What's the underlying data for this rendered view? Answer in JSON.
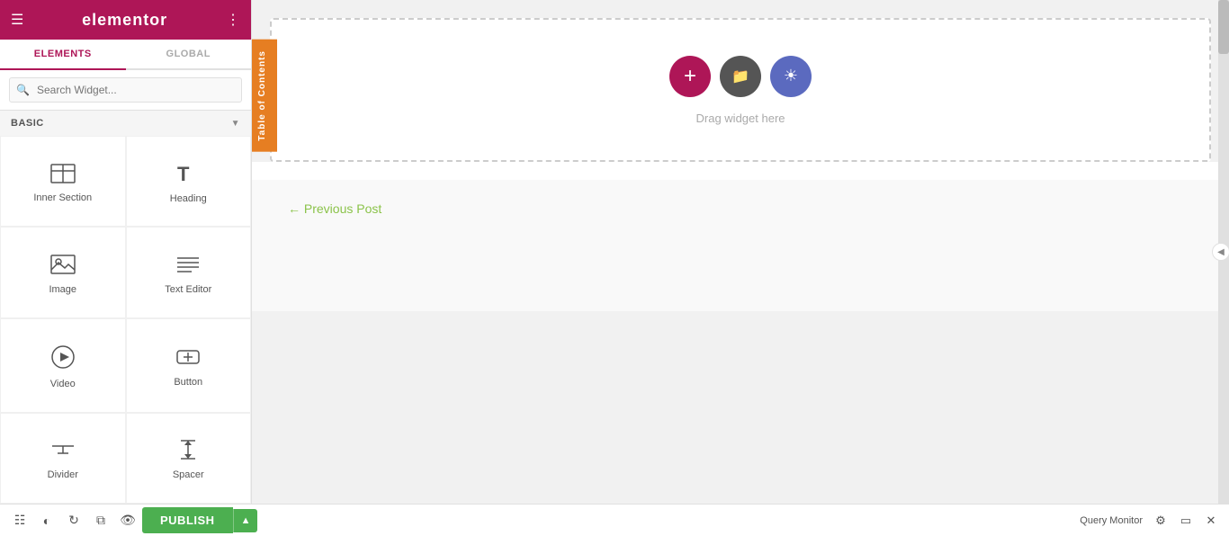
{
  "header": {
    "title": "elementor",
    "hamburger_label": "menu",
    "grid_label": "grid"
  },
  "sidebar": {
    "tabs": [
      {
        "label": "ELEMENTS",
        "active": true
      },
      {
        "label": "GLOBAL",
        "active": false
      }
    ],
    "search": {
      "placeholder": "Search Widget..."
    },
    "section_label": "BASIC",
    "widgets": [
      {
        "id": "inner-section",
        "label": "Inner Section",
        "icon": "inner-section"
      },
      {
        "id": "heading",
        "label": "Heading",
        "icon": "heading"
      },
      {
        "id": "image",
        "label": "Image",
        "icon": "image"
      },
      {
        "id": "text-editor",
        "label": "Text Editor",
        "icon": "text-editor"
      },
      {
        "id": "video",
        "label": "Video",
        "icon": "video"
      },
      {
        "id": "button",
        "label": "Button",
        "icon": "button"
      },
      {
        "id": "divider",
        "label": "Divider",
        "icon": "divider"
      },
      {
        "id": "spacer",
        "label": "Spacer",
        "icon": "spacer"
      }
    ]
  },
  "toc": {
    "label": "Table of Contents"
  },
  "canvas": {
    "drop_text": "Drag widget here",
    "buttons": [
      {
        "id": "add",
        "icon": "+",
        "color": "#ae1657"
      },
      {
        "id": "folder",
        "icon": "folder",
        "color": "#555"
      },
      {
        "id": "cloud",
        "icon": "cloud",
        "color": "#5b6abf"
      }
    ]
  },
  "prev_post": {
    "label": "← Previous Post"
  },
  "bottom_toolbar": {
    "icons": [
      {
        "id": "layers",
        "icon": "⊟"
      },
      {
        "id": "history",
        "icon": "↩"
      },
      {
        "id": "undo",
        "icon": "↺"
      },
      {
        "id": "copy",
        "icon": "⧉"
      },
      {
        "id": "eye",
        "icon": "👁"
      }
    ],
    "publish_label": "PUBLISH",
    "publish_arrow": "▲",
    "query_monitor": "Query Monitor",
    "bottom_right_icons": [
      {
        "id": "settings",
        "icon": "⚙"
      },
      {
        "id": "responsive",
        "icon": "⊡"
      },
      {
        "id": "close",
        "icon": "✕"
      }
    ]
  }
}
